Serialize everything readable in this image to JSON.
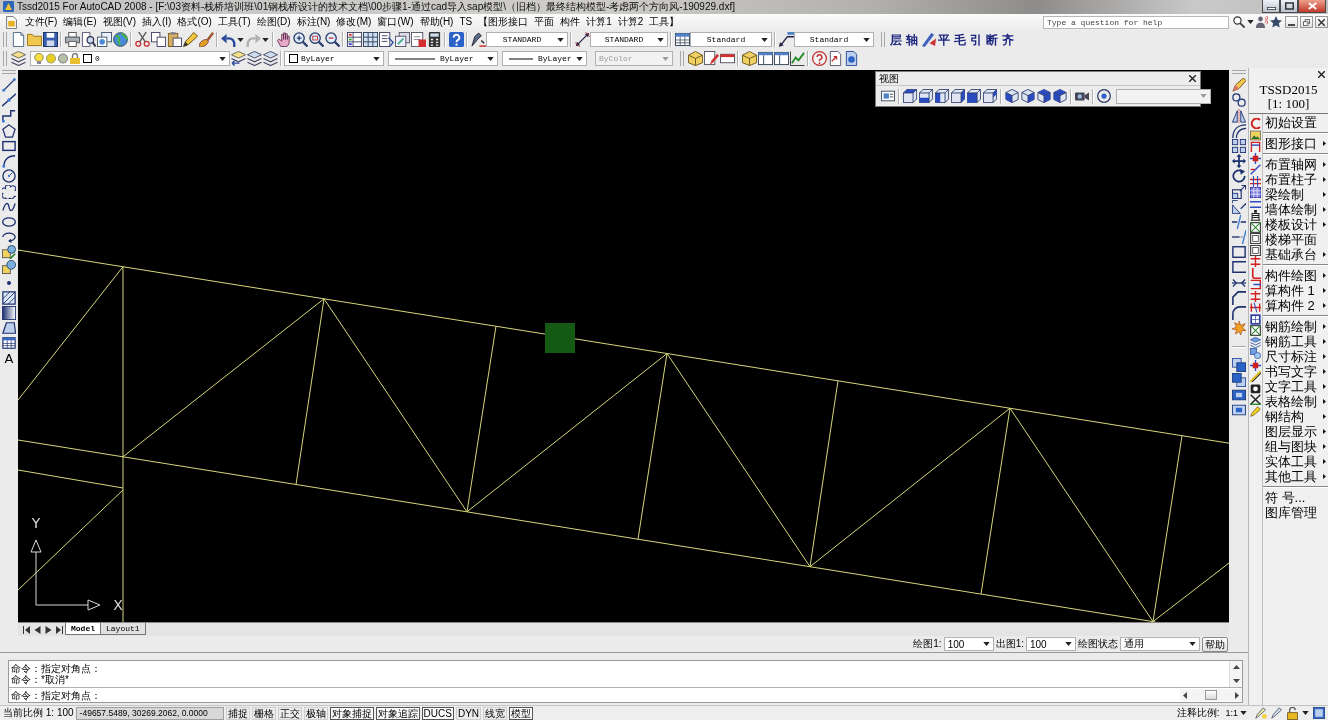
{
  "window": {
    "title": "Tssd2015 For AutoCAD 2008 - [F:\\03资料-栈桥培训班\\01钢栈桥设计的技术文档\\00步骤1-通过cad导入sap模型\\（旧档）最终结构模型-考虑两个方向风-190929.dxf]"
  },
  "menu_bar": {
    "items": [
      "文件(F)",
      "编辑(E)",
      "视图(V)",
      "插入(I)",
      "格式(O)",
      "工具(T)",
      "绘图(D)",
      "标注(N)",
      "修改(M)",
      "窗口(W)",
      "帮助(H)",
      "TS",
      "【图形接口",
      "平面",
      "构件",
      "计算1",
      "计算2",
      "工具】"
    ],
    "help_search": {
      "placeholder": "Type a question for help"
    }
  },
  "styles_toolbar": {
    "text_style": "STANDARD",
    "dimension_style": "STANDARD",
    "table_style": "Standard",
    "multileader_style": "Standard"
  },
  "tssd_toolbar": {
    "buttons": [
      {
        "kind": "text",
        "label": "层"
      },
      {
        "kind": "text",
        "label": "轴"
      },
      {
        "kind": "icon"
      },
      {
        "kind": "text",
        "label": "平"
      },
      {
        "kind": "text",
        "label": "毛"
      },
      {
        "kind": "text",
        "label": "引"
      },
      {
        "kind": "text",
        "label": "断"
      },
      {
        "kind": "text",
        "label": "齐"
      }
    ]
  },
  "properties_toolbar": {
    "layer": "0",
    "color_control": "ByLayer",
    "linetype": "ByLayer",
    "lineweight": "ByLayer",
    "plot_style": {
      "value": "ByColor",
      "disabled": true
    }
  },
  "draw_toolbar": {
    "text_tool": "A"
  },
  "canvas": {
    "ucs_x": "X",
    "ucs_y": "Y"
  },
  "view_toolbar": {
    "title": "视图",
    "view_list": {
      "disabled": true
    }
  },
  "layout_tabs": [
    {
      "label": "Model",
      "selected": true
    },
    {
      "label": "Layout1",
      "selected": false
    }
  ],
  "tssd_panel": {
    "title": "TSSD2015",
    "scale": "[1: 100]",
    "groups": [
      {
        "items": [
          {
            "label": "初始设置",
            "submenu": false
          }
        ]
      },
      {
        "items": [
          {
            "label": "图形接口",
            "submenu": true
          }
        ]
      },
      {
        "items": [
          {
            "label": "布置轴网",
            "submenu": true
          },
          {
            "label": "布置柱子",
            "submenu": true
          },
          {
            "label": "梁绘制",
            "submenu": true
          },
          {
            "label": "墙体绘制",
            "submenu": true
          },
          {
            "label": "楼板设计",
            "submenu": true
          },
          {
            "label": "楼梯平面",
            "submenu": false
          },
          {
            "label": "基础承台",
            "submenu": true
          }
        ]
      },
      {
        "items": [
          {
            "label": "构件绘图",
            "submenu": true
          },
          {
            "label": "算构件 1",
            "submenu": true
          },
          {
            "label": "算构件 2",
            "submenu": true
          }
        ]
      },
      {
        "items": [
          {
            "label": "钢筋绘制",
            "submenu": true
          },
          {
            "label": "钢筋工具",
            "submenu": true
          },
          {
            "label": "尺寸标注",
            "submenu": true
          },
          {
            "label": "书写文字",
            "submenu": true
          },
          {
            "label": "文字工具",
            "submenu": true
          },
          {
            "label": "表格绘制",
            "submenu": true
          },
          {
            "label": "钢结构",
            "submenu": true
          },
          {
            "label": "图层显示",
            "submenu": true
          },
          {
            "label": "组与图块",
            "submenu": true
          },
          {
            "label": "实体工具",
            "submenu": true
          },
          {
            "label": "其他工具",
            "submenu": true
          }
        ]
      },
      {
        "items": [
          {
            "label": "符 号...",
            "submenu": false
          },
          {
            "label": "图库管理",
            "submenu": false
          }
        ]
      }
    ]
  },
  "drawing_settings": {
    "drawing_scale_label": "绘图1:",
    "drawing_scale": "100",
    "output_scale_label": "出图1:",
    "output_scale": "100",
    "state_label": "绘图状态",
    "state": "通用",
    "help": "帮助"
  },
  "command_window": {
    "history": [
      "命令：指定对角点：",
      "命令：*取消*"
    ],
    "prompt": "命令：指定对角点："
  },
  "status_bar": {
    "scale": "当前比例 1: 100",
    "coordinates": "-49657.5489, 30269.2062, 0.0000",
    "toggles": [
      {
        "label": "捕捉",
        "on": false
      },
      {
        "label": "栅格",
        "on": false
      },
      {
        "label": "正交",
        "on": false
      },
      {
        "label": "极轴",
        "on": false
      },
      {
        "label": "对象捕捉",
        "on": true
      },
      {
        "label": "对象追踪",
        "on": true
      },
      {
        "label": "DUCS",
        "on": true
      },
      {
        "label": "DYN",
        "on": false
      },
      {
        "label": "线宽",
        "on": false
      },
      {
        "label": "模型",
        "on": true
      }
    ],
    "annotation_scale_label": "注释比例:",
    "annotation_scale": "1:1"
  }
}
